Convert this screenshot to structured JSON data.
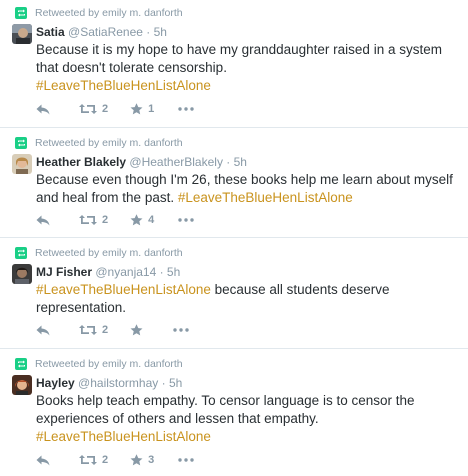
{
  "retweeted_by": "Retweeted by emily m. danforth",
  "colors": {
    "hashtag": "#c9931e",
    "meta": "#8899a6",
    "retweet_green": "#19cf86",
    "text": "#292f33"
  },
  "icons": [
    "retweet-badge-icon",
    "reply-icon",
    "retweet-icon",
    "favorite-star-icon",
    "more-dots-icon"
  ],
  "tweets": [
    {
      "name": "Satia",
      "handle": "@SatiaRenee",
      "sep": " · ",
      "time": "5h",
      "line1": "Because it is my hope to have my granddaughter raised in a system",
      "line2": "that doesn't tolerate censorship.",
      "hashtag": "#LeaveTheBlueHenListAlone",
      "retweets": "2",
      "favorites": "1"
    },
    {
      "name": "Heather Blakely",
      "handle": "@HeatherBlakely",
      "sep": " · ",
      "time": "5h",
      "line1": "Because even though I'm 26, these books help me learn about myself",
      "line2": "and heal from the past. ",
      "hashtag": "#LeaveTheBlueHenListAlone",
      "retweets": "2",
      "favorites": "4"
    },
    {
      "name": "MJ Fisher",
      "handle": "@nyanja14",
      "sep": " · ",
      "time": "5h",
      "hashtag": "#LeaveTheBlueHenListAlone",
      "line1_rest": " because all students deserve",
      "line2": "representation.",
      "retweets": "2",
      "favorites": ""
    },
    {
      "name": "Hayley",
      "handle": "@hailstormhay",
      "sep": " · ",
      "time": "5h",
      "line1": "Books help teach empathy. To censor language is to censor the",
      "line2": "experiences of others and lessen that empathy.",
      "hashtag": "#LeaveTheBlueHenListAlone",
      "retweets": "2",
      "favorites": "3"
    }
  ]
}
